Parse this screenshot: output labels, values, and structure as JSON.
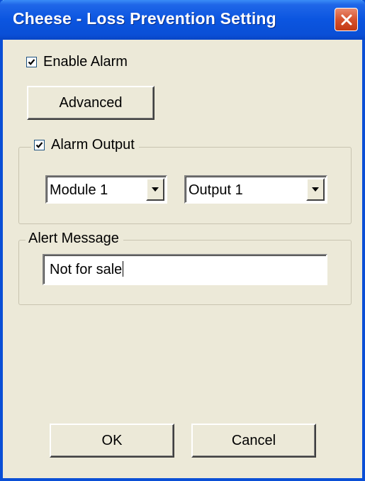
{
  "window": {
    "title": "Cheese - Loss Prevention Setting"
  },
  "enable_alarm": {
    "label": "Enable Alarm",
    "checked": true
  },
  "advanced_button": {
    "label": "Advanced"
  },
  "alarm_output": {
    "label": "Alarm Output",
    "checked": true,
    "module_select": {
      "value": "Module 1"
    },
    "output_select": {
      "value": "Output 1"
    }
  },
  "alert_message": {
    "label": "Alert Message",
    "value": "Not for sale"
  },
  "footer": {
    "ok_label": "OK",
    "cancel_label": "Cancel"
  },
  "colors": {
    "titlebar": "#0a4fd6",
    "dialog_bg": "#ece9d8",
    "close_button": "#d6522e"
  }
}
